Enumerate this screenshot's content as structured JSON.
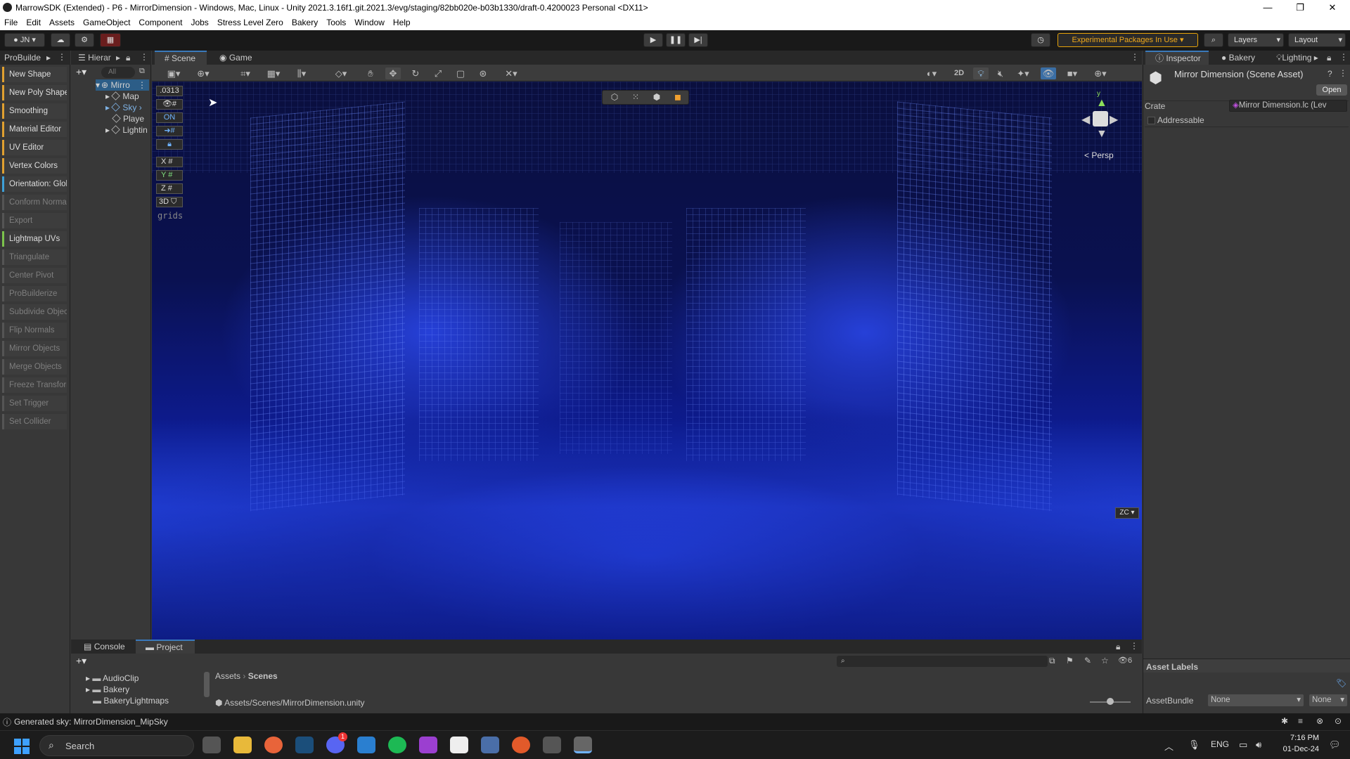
{
  "window": {
    "title": "MarrowSDK (Extended) - P6 - MirrorDimension - Windows, Mac, Linux - Unity 2021.3.16f1.git.2021.3/evg/staging/82bb020e-b03b1330/draft-0.4200023 Personal <DX11>",
    "minimize": "—",
    "maximize": "❐",
    "close": "✕"
  },
  "menu": [
    "File",
    "Edit",
    "Assets",
    "GameObject",
    "Component",
    "Jobs",
    "Stress Level Zero",
    "Bakery",
    "Tools",
    "Window",
    "Help"
  ],
  "toolbar": {
    "account": "JN",
    "experimental": "Experimental Packages In Use",
    "layers": "Layers",
    "layout": "Layout"
  },
  "probuilder": {
    "title": "ProBuilde",
    "items": [
      {
        "label": "New Shape",
        "state": "o"
      },
      {
        "label": "New Poly Shape",
        "state": "o"
      },
      {
        "label": "Smoothing",
        "state": "o"
      },
      {
        "label": "Material Editor",
        "state": "o"
      },
      {
        "label": "UV Editor",
        "state": "o"
      },
      {
        "label": "Vertex Colors",
        "state": "o"
      },
      {
        "label": "Orientation: Glob",
        "state": "b"
      },
      {
        "label": "Conform Normal",
        "state": "dim"
      },
      {
        "label": "Export",
        "state": "dim"
      },
      {
        "label": "Lightmap UVs",
        "state": "g"
      },
      {
        "label": "Triangulate",
        "state": "dim"
      },
      {
        "label": "Center Pivot",
        "state": "dim"
      },
      {
        "label": "ProBuilderize",
        "state": "dim"
      },
      {
        "label": "Subdivide Object",
        "state": "dim"
      },
      {
        "label": "Flip Normals",
        "state": "dim"
      },
      {
        "label": "Mirror Objects",
        "state": "dim"
      },
      {
        "label": "Merge Objects",
        "state": "dim"
      },
      {
        "label": "Freeze Transform",
        "state": "dim"
      },
      {
        "label": "Set Trigger",
        "state": "dim"
      },
      {
        "label": "Set Collider",
        "state": "dim"
      }
    ]
  },
  "hierarchy": {
    "title": "Hierar",
    "search_placeholder": "All",
    "root": "Mirro",
    "children": [
      "Map",
      "Sky",
      "Playe",
      "Lightin"
    ]
  },
  "scene": {
    "tabs": [
      "Scene",
      "Game"
    ],
    "toggle_2d": "2D",
    "overlay_value": ".0313",
    "overlay_on": "ON",
    "axes": [
      "X",
      "Y",
      "Z"
    ],
    "label_3d": "3D",
    "grids_label": "grids",
    "persp": "< Persp",
    "gizmo_y": "y",
    "corner": "ZC"
  },
  "inspector": {
    "tabs": [
      "Inspector",
      "Bakery",
      "Lighting"
    ],
    "asset_title": "Mirror Dimension (Scene Asset)",
    "open_button": "Open",
    "crate_label": "Crate",
    "crate_value": "Mirror Dimension.lc (Lev",
    "addressable": "Addressable",
    "asset_labels": "Asset Labels",
    "assetbundle_label": "AssetBundle",
    "assetbundle_value": "None",
    "assetbundle_variant": "None"
  },
  "bottom": {
    "tabs": [
      "Console",
      "Project"
    ],
    "folders": [
      "AudioClip",
      "Bakery",
      "BakeryLightmaps"
    ],
    "breadcrumb_root": "Assets",
    "breadcrumb_leaf": "Scenes",
    "path": "Assets/Scenes/MirrorDimension.unity",
    "hidden_count": "6"
  },
  "status": {
    "message": "Generated sky: MirrorDimension_MipSky"
  },
  "taskbar": {
    "search": "Search",
    "lang": "ENG",
    "time": "7:16 PM",
    "date": "01-Dec-24",
    "discord_badge": "1"
  }
}
